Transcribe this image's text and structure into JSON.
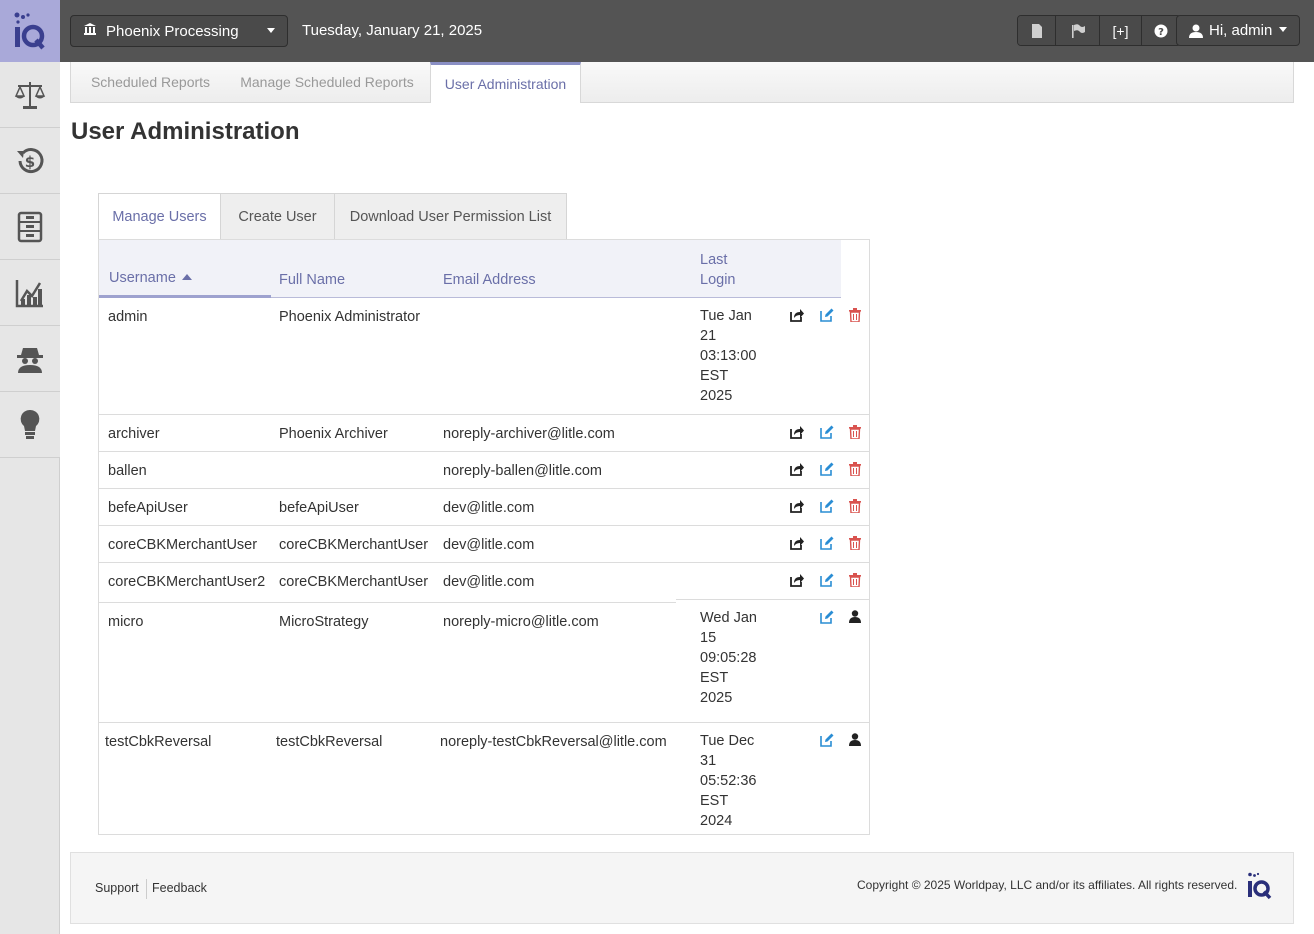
{
  "app": {
    "organization": "Phoenix Processing",
    "date": "Tuesday, January 21, 2025",
    "user_greeting": "Hi, admin",
    "expand_label": "[+]"
  },
  "sidebar": {
    "items": [
      {
        "icon": "scale-icon"
      },
      {
        "icon": "dollar-history-icon"
      },
      {
        "icon": "file-cabinet-icon"
      },
      {
        "icon": "line-chart-icon"
      },
      {
        "icon": "spy-icon"
      },
      {
        "icon": "lightbulb-icon"
      }
    ]
  },
  "report_tabs": [
    {
      "label": "Scheduled Reports"
    },
    {
      "label": "Manage Scheduled Reports"
    },
    {
      "label": "User Administration"
    }
  ],
  "page_title": "User Administration",
  "sub_tabs": [
    {
      "label": "Manage Users"
    },
    {
      "label": "Create User"
    },
    {
      "label": "Download User Permission List"
    }
  ],
  "table": {
    "headers": {
      "username": "Username",
      "full_name": "Full Name",
      "email": "Email Address",
      "last_login_1": "Last",
      "last_login_2": "Login"
    },
    "rows": [
      {
        "username": "admin",
        "full_name": "Phoenix Administrator",
        "email": "",
        "login": [
          "Tue Jan",
          "21",
          "03:13:00",
          "EST",
          "2025"
        ]
      },
      {
        "username": "archiver",
        "full_name": "Phoenix Archiver",
        "email": "noreply-archiver@litle.com",
        "login": []
      },
      {
        "username": "ballen",
        "full_name": "",
        "email": "noreply-ballen@litle.com",
        "login": []
      },
      {
        "username": "befeApiUser",
        "full_name": "befeApiUser",
        "email": "dev@litle.com",
        "login": []
      },
      {
        "username": "coreCBKMerchantUser",
        "full_name": "coreCBKMerchantUser",
        "email": "dev@litle.com",
        "login": []
      },
      {
        "username": "coreCBKMerchantUser2",
        "full_name": "coreCBKMerchantUser",
        "email": "dev@litle.com",
        "login": []
      },
      {
        "username": "micro",
        "full_name": "MicroStrategy",
        "email": "noreply-micro@litle.com",
        "login": [
          "Wed Jan",
          "15",
          "09:05:28",
          "EST",
          "2025"
        ]
      },
      {
        "username": "testCbkReversal",
        "full_name": "testCbkReversal",
        "email": "noreply-testCbkReversal@litle.com",
        "login": [
          "Tue Dec",
          "31",
          "05:52:36",
          "EST",
          "2024"
        ]
      }
    ]
  },
  "footer": {
    "support": "Support",
    "feedback": "Feedback",
    "copyright": "Copyright © 2025 Worldpay, LLC and/or its affiliates. All rights reserved."
  },
  "colors": {
    "accent": "#6a6fa8",
    "topbar": "#545454",
    "logo_bg": "#a9a9d9",
    "edit_blue": "#2a8dd4",
    "delete_red": "#d9534f"
  }
}
